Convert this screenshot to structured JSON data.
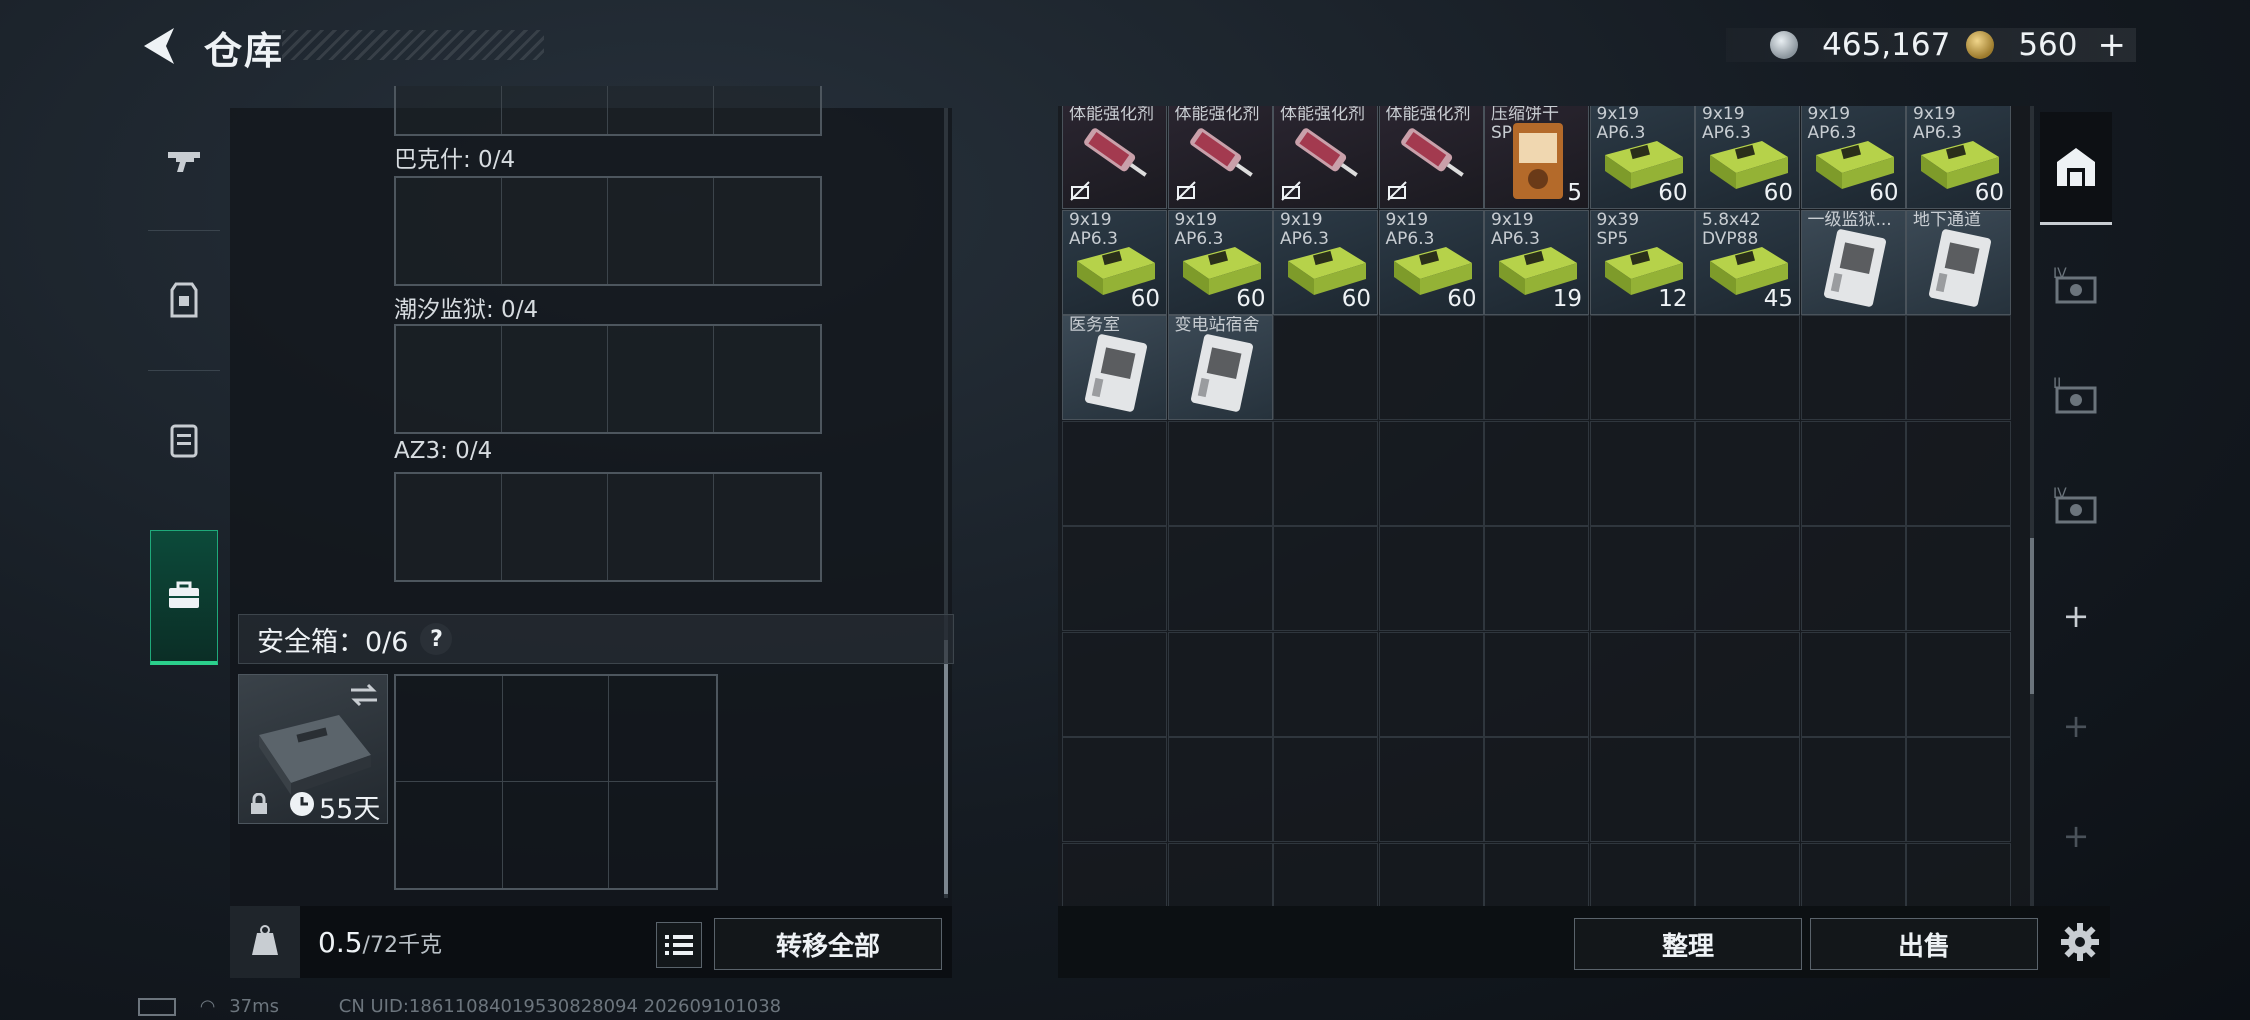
{
  "header": {
    "title": "仓库",
    "currency_silver": "465,167",
    "currency_gold": "560"
  },
  "nav": {
    "items": [
      {
        "name": "weapon"
      },
      {
        "name": "armor"
      },
      {
        "name": "backpack"
      },
      {
        "name": "key-case"
      }
    ]
  },
  "left_panel": {
    "slots": [
      {
        "label": "巴克什: 0/4"
      },
      {
        "label": "潮汐监狱: 0/4"
      },
      {
        "label": "AZ3: 0/4"
      }
    ],
    "safebox_title": "安全箱：0/6",
    "help": "?",
    "safebox_days": "55天",
    "weight": "0.5",
    "weight_max": "/72千克",
    "transfer_all": "转移全部"
  },
  "storage": {
    "items_row1": [
      {
        "name": "体能强化剂",
        "count": ""
      },
      {
        "name": "体能强化剂",
        "count": ""
      },
      {
        "name": "体能强化剂",
        "count": ""
      },
      {
        "name": "体能强化剂",
        "count": ""
      },
      {
        "name": "压缩饼干",
        "sub": "SP",
        "count": "5"
      },
      {
        "name": "9x19",
        "sub": "AP6.3",
        "count": "60"
      },
      {
        "name": "9x19",
        "sub": "AP6.3",
        "count": "60"
      },
      {
        "name": "9x19",
        "sub": "AP6.3",
        "count": "60"
      },
      {
        "name": "9x19",
        "sub": "AP6.3",
        "count": "60"
      }
    ],
    "items_row2": [
      {
        "name": "9x19",
        "sub": "AP6.3",
        "count": "60"
      },
      {
        "name": "9x19",
        "sub": "AP6.3",
        "count": "60"
      },
      {
        "name": "9x19",
        "sub": "AP6.3",
        "count": "60"
      },
      {
        "name": "9x19",
        "sub": "AP6.3",
        "count": "60"
      },
      {
        "name": "9x19",
        "sub": "AP6.3",
        "count": "19"
      },
      {
        "name": "9x39",
        "sub": "SP5",
        "count": "12"
      },
      {
        "name": "5.8x42",
        "sub": "DVP88",
        "count": "45"
      },
      {
        "name": "一级监狱...",
        "sub": "",
        "count": ""
      },
      {
        "name": "地下通道",
        "sub": "",
        "count": ""
      }
    ],
    "items_row3": [
      {
        "name": "医务室",
        "sub": "",
        "count": ""
      },
      {
        "name": "变电站宿舍",
        "sub": "",
        "count": ""
      }
    ],
    "sort_button": "整理",
    "sell_button": "出售"
  },
  "status": {
    "ping": "37ms",
    "uid": "CN UID:18611084019530828094 202609101038"
  },
  "colors": {
    "accent_green": "#2bd08c",
    "ammo_green": "#9fc23f",
    "card_gray": "#d8dadc"
  }
}
